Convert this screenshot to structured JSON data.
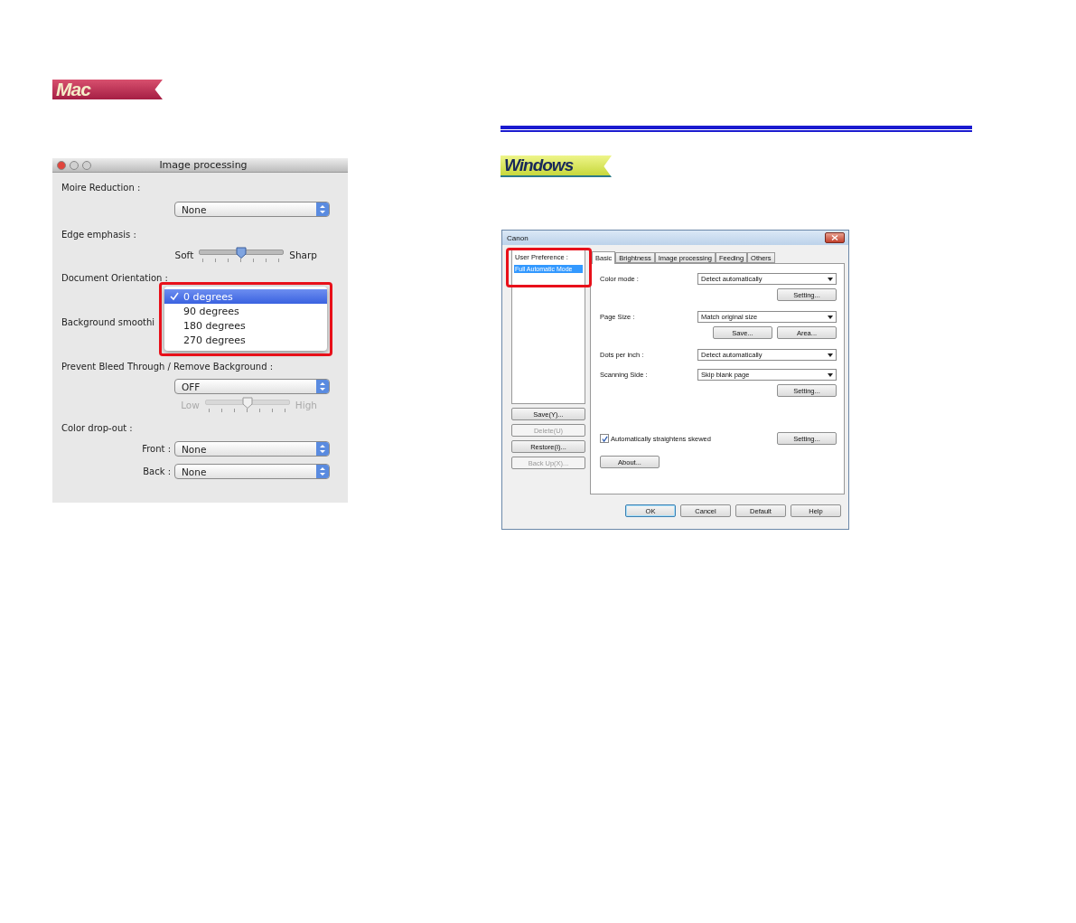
{
  "mac_badge": {
    "label": "Mac"
  },
  "mac_window": {
    "title": "Image processing",
    "moire": {
      "label": "Moire Reduction :",
      "value": "None"
    },
    "edge": {
      "label": "Edge emphasis :",
      "min_label": "Soft",
      "max_label": "Sharp",
      "level": 0.5
    },
    "orientation": {
      "label": "Document Orientation :",
      "options": [
        {
          "label": "0 degrees",
          "selected": true
        },
        {
          "label": "90 degrees",
          "selected": false
        },
        {
          "label": "180 degrees",
          "selected": false
        },
        {
          "label": "270 degrees",
          "selected": false
        }
      ]
    },
    "background_smoothing": {
      "label": "Background smoothi"
    },
    "bleed": {
      "label": "Prevent Bleed Through / Remove Background :",
      "value": "OFF",
      "min_label": "Low",
      "max_label": "High",
      "level": 0.5,
      "disabled": true
    },
    "color_dropout": {
      "label": "Color drop-out :",
      "fields": [
        {
          "label": "Front :",
          "value": "None"
        },
        {
          "label": "Back :",
          "value": "None"
        }
      ]
    }
  },
  "windows_badge": {
    "label": "Windows"
  },
  "windows_dialog": {
    "title": "Canon",
    "user_preference": {
      "label": "User Preference :",
      "items": [
        {
          "label": "Full Automatic Mode",
          "selected": true
        }
      ]
    },
    "side_buttons": [
      {
        "label": "Save(Y)...",
        "disabled": false
      },
      {
        "label": "Delete(U)",
        "disabled": true
      },
      {
        "label": "Restore(I)...",
        "disabled": false
      },
      {
        "label": "Back Up(X)...",
        "disabled": true
      }
    ],
    "tabs": [
      {
        "label": "Basic",
        "selected": true
      },
      {
        "label": "Brightness",
        "selected": false
      },
      {
        "label": "Image processing",
        "selected": false
      },
      {
        "label": "Feeding",
        "selected": false
      },
      {
        "label": "Others",
        "selected": false
      }
    ],
    "rows": [
      {
        "label": "Color mode :",
        "value": "Detect automatically",
        "buttons": [
          "Setting..."
        ]
      },
      {
        "label": "Page Size :",
        "value": "Match original size",
        "buttons": [
          "Save...",
          "Area..."
        ]
      },
      {
        "label": "Dots per inch :",
        "value": "Detect automatically",
        "buttons": []
      },
      {
        "label": "Scanning Side :",
        "value": "Skip blank page",
        "buttons": [
          "Setting..."
        ]
      }
    ],
    "checkbox": {
      "label": "Automatically straightens skewed",
      "checked": true,
      "button": "Setting..."
    },
    "about_button": "About...",
    "footer_buttons": [
      {
        "label": "OK",
        "default": true
      },
      {
        "label": "Cancel",
        "default": false
      },
      {
        "label": "Default",
        "default": false
      },
      {
        "label": "Help",
        "default": false
      }
    ]
  }
}
